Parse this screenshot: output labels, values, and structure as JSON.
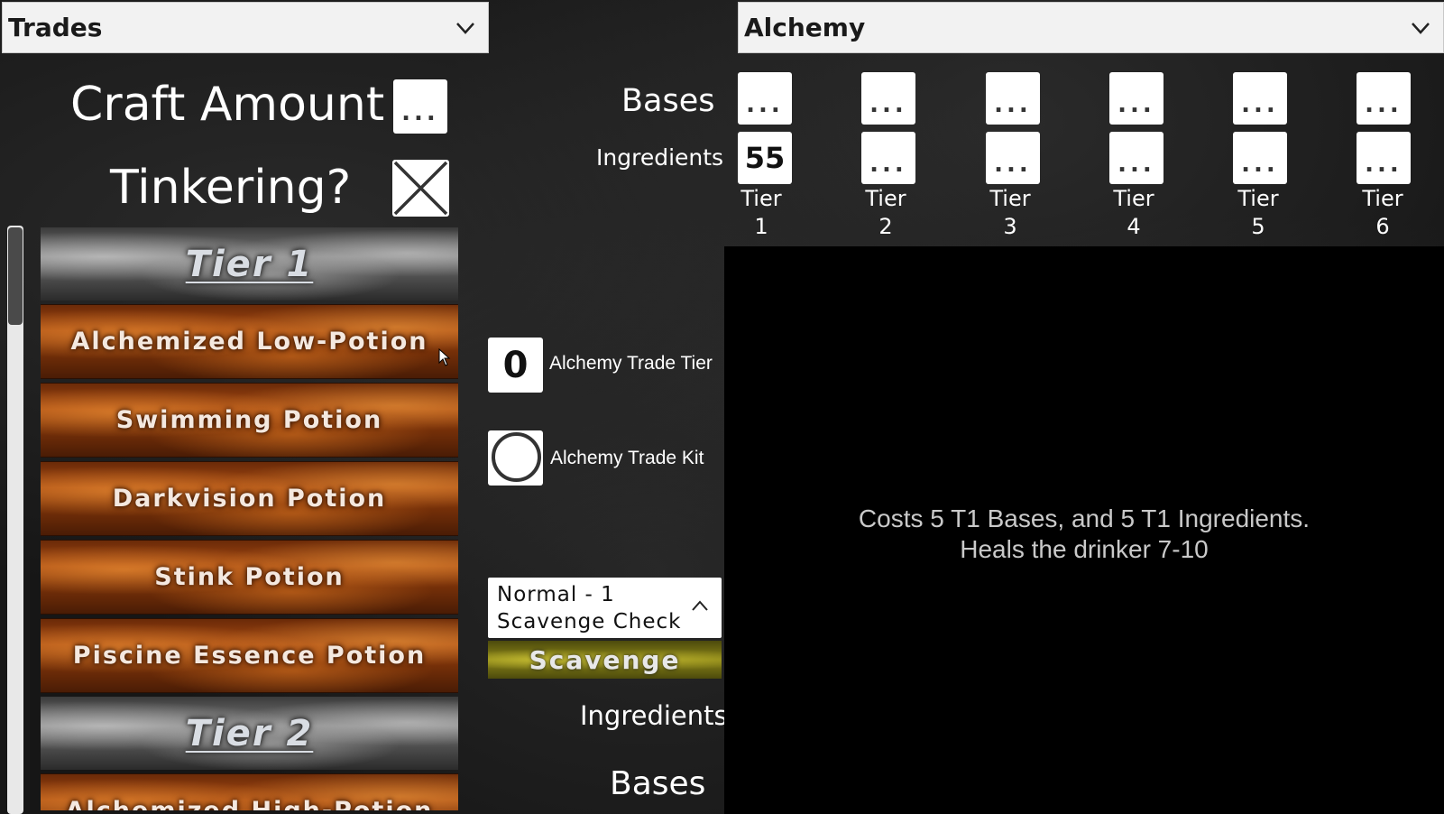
{
  "left_dropdown": {
    "value": "Trades"
  },
  "right_dropdown": {
    "value": "Alchemy"
  },
  "craft_amount": {
    "label": "Craft Amount",
    "value": "..."
  },
  "tinkering": {
    "label": "Tinkering?",
    "checked": true
  },
  "recipe_list": {
    "tier1_header": "Tier 1",
    "tier1_items": [
      "Alchemized Low-Potion",
      "Swimming Potion",
      "Darkvision Potion",
      "Stink Potion",
      "Piscine Essence Potion"
    ],
    "tier2_header": "Tier 2",
    "tier2_items": [
      "Alchemized High-Potion"
    ]
  },
  "resources": {
    "bases_label": "Bases",
    "ingredients_label": "Ingredients",
    "bases_values": [
      "...",
      "...",
      "...",
      "...",
      "...",
      "..."
    ],
    "ingredients_values": [
      "55",
      "...",
      "...",
      "...",
      "...",
      "..."
    ],
    "tier_word": "Tier",
    "tiers": [
      "1",
      "2",
      "3",
      "4",
      "5",
      "6"
    ]
  },
  "trade_tier": {
    "value": "0",
    "label": "Alchemy Trade Tier"
  },
  "trade_kit": {
    "label": "Alchemy Trade Kit",
    "checked": false
  },
  "scavenge_select": {
    "value": "Normal - 1 Scavenge Check"
  },
  "scavenge_button": {
    "label": "Scavenge"
  },
  "scavenge_outputs": {
    "ingredients_label": "Ingredients",
    "bases_label": "Bases"
  },
  "description": {
    "line1": "Costs 5 T1 Bases, and 5 T1 Ingredients.",
    "line2": "Heals the drinker 7-10"
  }
}
